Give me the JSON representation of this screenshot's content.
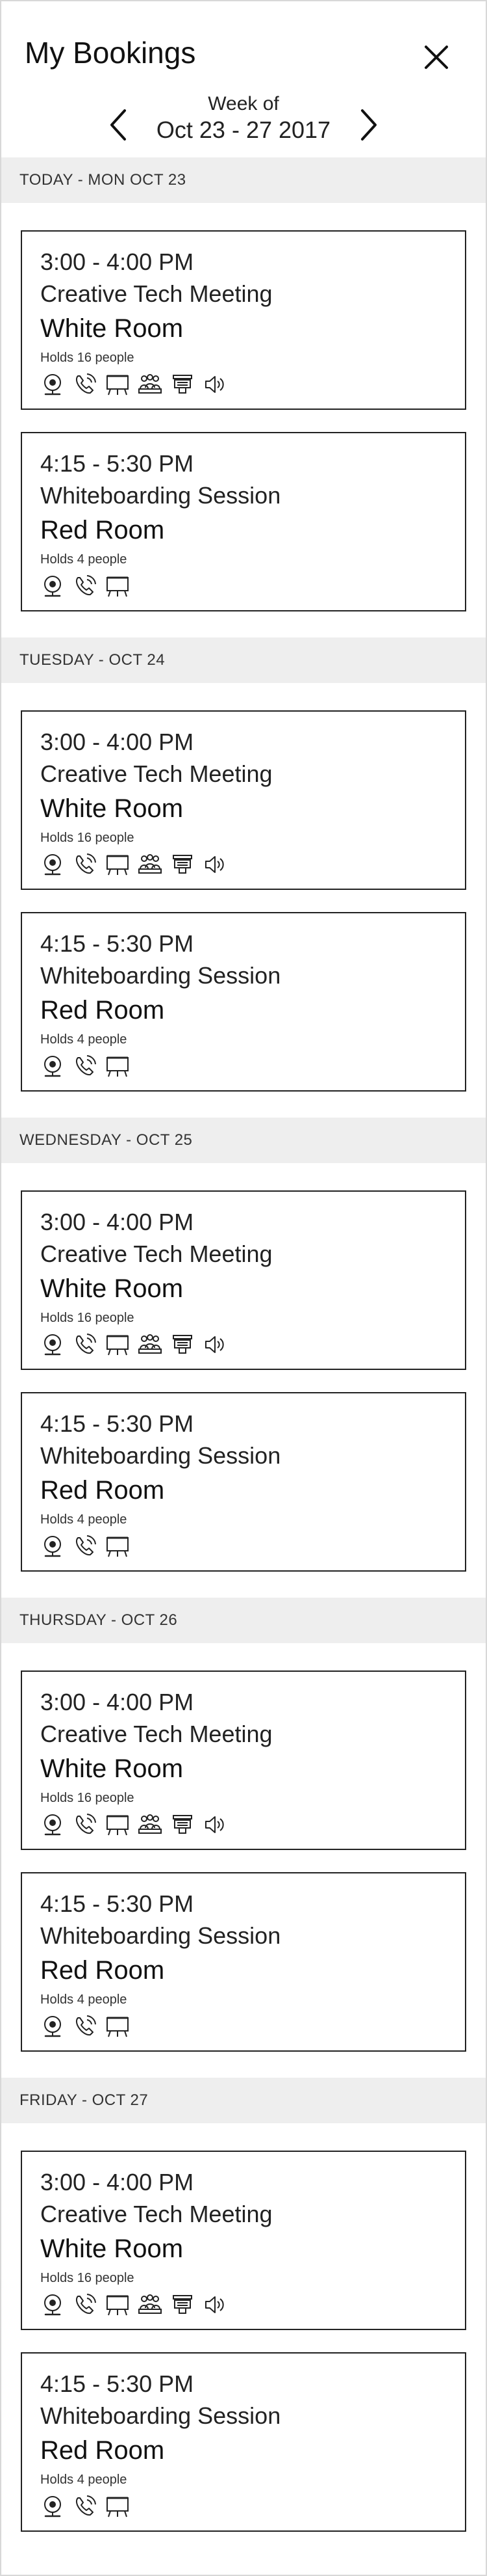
{
  "header": {
    "title": "My Bookings",
    "week_label": "Week of",
    "week_range": "Oct 23 - 27 2017",
    "close_icon": "close-icon",
    "prev_icon": "chevron-left-icon",
    "next_icon": "chevron-right-icon"
  },
  "days": [
    {
      "label": "TODAY - MON OCT 23",
      "bookings": [
        {
          "time": "3:00 - 4:00 PM",
          "meeting": "Creative Tech Meeting",
          "room": "White Room",
          "capacity": "Holds 16 people",
          "amenities": [
            "webcam-icon",
            "phone-icon",
            "display-icon",
            "seating-icon",
            "projector-icon",
            "speaker-icon"
          ]
        },
        {
          "time": "4:15 - 5:30 PM",
          "meeting": "Whiteboarding Session",
          "room": "Red Room",
          "capacity": "Holds 4 people",
          "amenities": [
            "webcam-icon",
            "phone-icon",
            "display-icon"
          ]
        }
      ]
    },
    {
      "label": "TUESDAY - OCT 24",
      "bookings": [
        {
          "time": "3:00 - 4:00 PM",
          "meeting": "Creative Tech Meeting",
          "room": "White Room",
          "capacity": "Holds 16 people",
          "amenities": [
            "webcam-icon",
            "phone-icon",
            "display-icon",
            "seating-icon",
            "projector-icon",
            "speaker-icon"
          ]
        },
        {
          "time": "4:15 - 5:30 PM",
          "meeting": "Whiteboarding Session",
          "room": "Red Room",
          "capacity": "Holds 4 people",
          "amenities": [
            "webcam-icon",
            "phone-icon",
            "display-icon"
          ]
        }
      ]
    },
    {
      "label": "WEDNESDAY - OCT 25",
      "bookings": [
        {
          "time": "3:00 - 4:00 PM",
          "meeting": "Creative Tech Meeting",
          "room": "White Room",
          "capacity": "Holds 16 people",
          "amenities": [
            "webcam-icon",
            "phone-icon",
            "display-icon",
            "seating-icon",
            "projector-icon",
            "speaker-icon"
          ]
        },
        {
          "time": "4:15 - 5:30 PM",
          "meeting": "Whiteboarding Session",
          "room": "Red Room",
          "capacity": "Holds 4 people",
          "amenities": [
            "webcam-icon",
            "phone-icon",
            "display-icon"
          ]
        }
      ]
    },
    {
      "label": "THURSDAY - OCT 26",
      "bookings": [
        {
          "time": "3:00 - 4:00 PM",
          "meeting": "Creative Tech Meeting",
          "room": "White Room",
          "capacity": "Holds 16 people",
          "amenities": [
            "webcam-icon",
            "phone-icon",
            "display-icon",
            "seating-icon",
            "projector-icon",
            "speaker-icon"
          ]
        },
        {
          "time": "4:15 - 5:30 PM",
          "meeting": "Whiteboarding Session",
          "room": "Red Room",
          "capacity": "Holds 4 people",
          "amenities": [
            "webcam-icon",
            "phone-icon",
            "display-icon"
          ]
        }
      ]
    },
    {
      "label": "FRIDAY - OCT 27",
      "bookings": [
        {
          "time": "3:00 - 4:00 PM",
          "meeting": "Creative Tech Meeting",
          "room": "White Room",
          "capacity": "Holds 16 people",
          "amenities": [
            "webcam-icon",
            "phone-icon",
            "display-icon",
            "seating-icon",
            "projector-icon",
            "speaker-icon"
          ]
        },
        {
          "time": "4:15 - 5:30 PM",
          "meeting": "Whiteboarding Session",
          "room": "Red Room",
          "capacity": "Holds 4 people",
          "amenities": [
            "webcam-icon",
            "phone-icon",
            "display-icon"
          ]
        }
      ]
    }
  ],
  "colors": {
    "text": "#222222",
    "day_header_bg": "#eeeeee",
    "card_border": "#222222"
  }
}
